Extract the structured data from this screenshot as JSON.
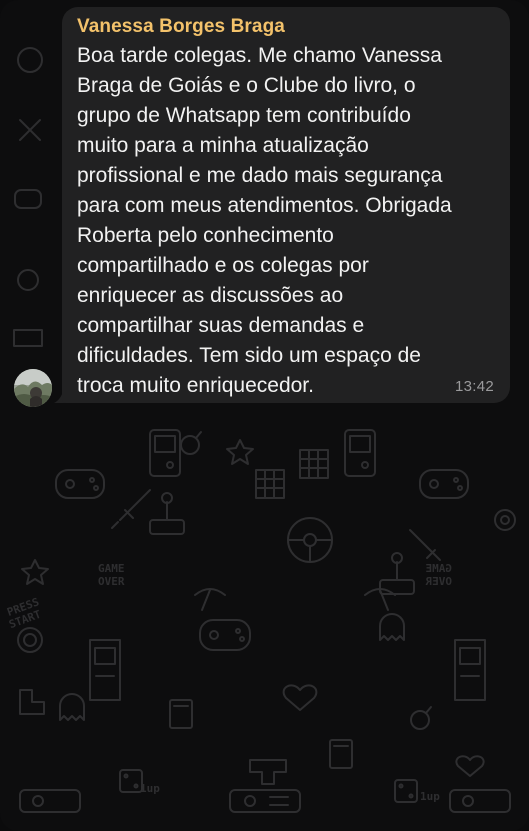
{
  "message": {
    "sender_name": "Vanessa Borges Braga",
    "text": "Boa tarde colegas. Me chamo Vanessa\nBraga de Goiás e o Clube do livro, o\ngrupo de Whatsapp tem contribuído\nmuito para a minha atualização\nprofissional e me dado mais segurança\npara com meus atendimentos. Obrigada\nRoberta pelo conhecimento\ncompartilhado e os colegas por\nenriquecer as discussões ao\ncompartilhar suas demandas e\ndificuldades. Tem sido um espaço de\ntroca muito enriquecedor.",
    "time": "13:42"
  },
  "avatar": {
    "icon": "sender-avatar-photo"
  },
  "background": {
    "pattern": "game-doodle-wallpaper",
    "pattern_labels": [
      "GAME OVER",
      "PRESS START",
      "1up"
    ]
  },
  "colors": {
    "background": "#0d0d0e",
    "bubble": "#212122",
    "sender_name": "#f3c26b",
    "message_text": "#f2f2f2",
    "timestamp": "#9a9a9c"
  }
}
